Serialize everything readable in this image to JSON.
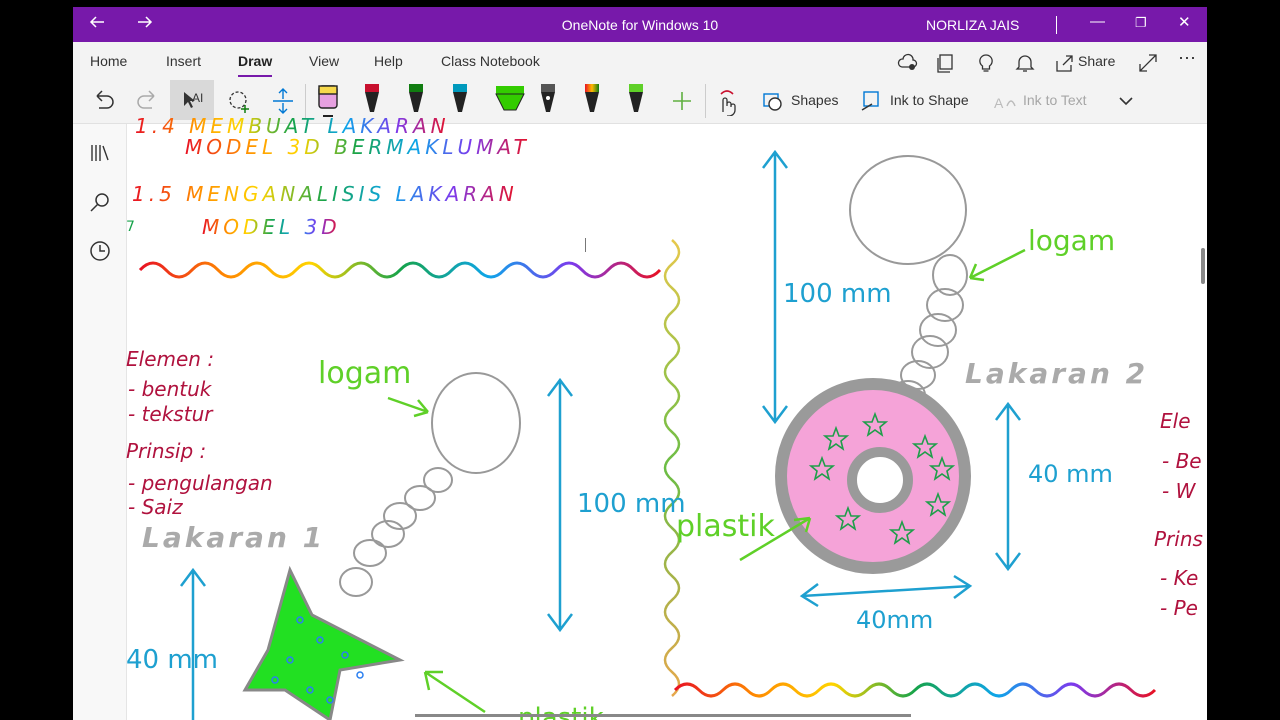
{
  "window": {
    "title": "OneNote for Windows 10",
    "user": "NORLIZA JAIS",
    "back_icon": "arrow-left-icon",
    "forward_icon": "arrow-right-icon",
    "minimize_glyph": "—",
    "restore_glyph": "❐",
    "close_glyph": "✕",
    "accent": "#7719aa"
  },
  "menu": {
    "tabs": [
      {
        "label": "Home"
      },
      {
        "label": "Insert"
      },
      {
        "label": "Draw",
        "active": true
      },
      {
        "label": "View"
      },
      {
        "label": "Help"
      },
      {
        "label": "Class Notebook"
      }
    ],
    "share_label": "Share"
  },
  "toolbar": {
    "shapes_label": "Shapes",
    "ink_to_shape_label": "Ink to Shape",
    "ink_to_text_label": "Ink to Text",
    "pens": [
      "#e6a0e0",
      "#c8102e",
      "#107c10",
      "#0099bc",
      "#33cc00",
      "#555555",
      "#e07b39",
      "#5fd028"
    ]
  },
  "canvas": {
    "notes": {
      "line1": "1.4  MEMBUAT  LAKARAN",
      "line2": "MODEL  3D  BERMAKLUMAT",
      "line3": "1.5  MENGANALISIS  LAKARAN",
      "line4": "MODEL  3D",
      "seven": "7"
    },
    "left_list": {
      "elemen": "Elemen :",
      "bentuk": "- bentuk",
      "tekstur": "- tekstur",
      "prinsip": "Prinsip :",
      "pengulangan": "- pengulangan",
      "saiz": "- Saiz"
    },
    "right_list": {
      "ele": "Ele",
      "be": "- Be",
      "w": "- W",
      "prins": "Prins",
      "ke": "- Ke",
      "pe": "- Pe"
    },
    "sketch1": {
      "title": "Lakaran 1",
      "logam": "logam",
      "height": "100 mm",
      "width": "40 mm",
      "plastik": "plastik"
    },
    "sketch2": {
      "title": "Lakaran 2",
      "logam": "logam",
      "height": "100 mm",
      "diameter": "40 mm",
      "width": "40mm",
      "plastik": "plastik"
    }
  }
}
